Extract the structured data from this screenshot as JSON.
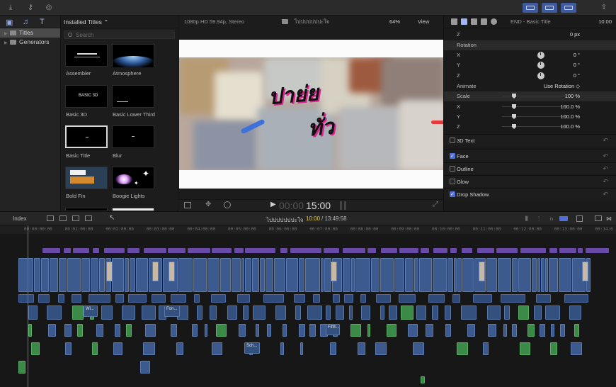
{
  "topbar": {
    "icons": [
      "import-icon",
      "key-icon",
      "check-icon"
    ],
    "share_icon": "share-icon"
  },
  "libraries": {
    "items": [
      {
        "label": "Titles",
        "selected": true
      },
      {
        "label": "Generators",
        "selected": false
      }
    ]
  },
  "browser": {
    "title": "Installed Titles ⌃",
    "search_placeholder": "Search",
    "tiles": [
      {
        "label": "Assembler"
      },
      {
        "label": "Atmosphere"
      },
      {
        "label": "Basic 3D"
      },
      {
        "label": "Basic Lower Third"
      },
      {
        "label": "Basic Title"
      },
      {
        "label": "Blur"
      },
      {
        "label": "Bold Fin"
      },
      {
        "label": "Boogie Lights"
      }
    ]
  },
  "viewer": {
    "format": "1080p HD 59.94p, Stereo",
    "project_title": "ไปปปปปปปะใจ",
    "zoom": "64%",
    "view_menu": "View",
    "overlay_line1": "ปาย่ย",
    "overlay_line2": "ทั่ว",
    "timecode_dim": "00:00",
    "timecode": "15:00"
  },
  "inspector": {
    "clip_name": "END - Basic Title",
    "duration": "10:00",
    "top_z": {
      "label": "Z",
      "value": "0 px"
    },
    "rotation_header": "Rotation",
    "rotation": [
      {
        "label": "X",
        "value": "0 °"
      },
      {
        "label": "Y",
        "value": "0 °"
      },
      {
        "label": "Z",
        "value": "0 °"
      }
    ],
    "animate_label": "Animate",
    "animate_value": "Use Rotation ◇",
    "scale": {
      "label": "Scale",
      "value": "100 %"
    },
    "scale_axes": [
      {
        "label": "X",
        "value": "100.0 %"
      },
      {
        "label": "Y",
        "value": "100.0 %"
      },
      {
        "label": "Z",
        "value": "100.0 %"
      }
    ],
    "sections": [
      {
        "label": "3D Text",
        "checked": false
      },
      {
        "label": "Face",
        "checked": true
      },
      {
        "label": "Outline",
        "checked": false
      },
      {
        "label": "Glow",
        "checked": false
      },
      {
        "label": "Drop Shadow",
        "checked": true
      }
    ]
  },
  "timeline": {
    "index_label": "Index",
    "project_name": "ไปปปปปปปะใจ",
    "position": "10:00",
    "duration": "/ 13:49:58",
    "ruler": [
      "00:00:00:00",
      "00:01:00:00",
      "00:02:00:00",
      "00:03:00:00",
      "00:04:00:00",
      "00:05:00:00",
      "00:06:00:00",
      "00:07:00:00",
      "00:08:00:00",
      "00:09:00:00",
      "00:10:00:00",
      "00:11:00:00",
      "00:12:00:00",
      "00:13:00:00",
      "00:14:0"
    ],
    "clip_labels": [
      "Wi...",
      "Fon...",
      "Fifth...",
      "Sch..."
    ]
  }
}
